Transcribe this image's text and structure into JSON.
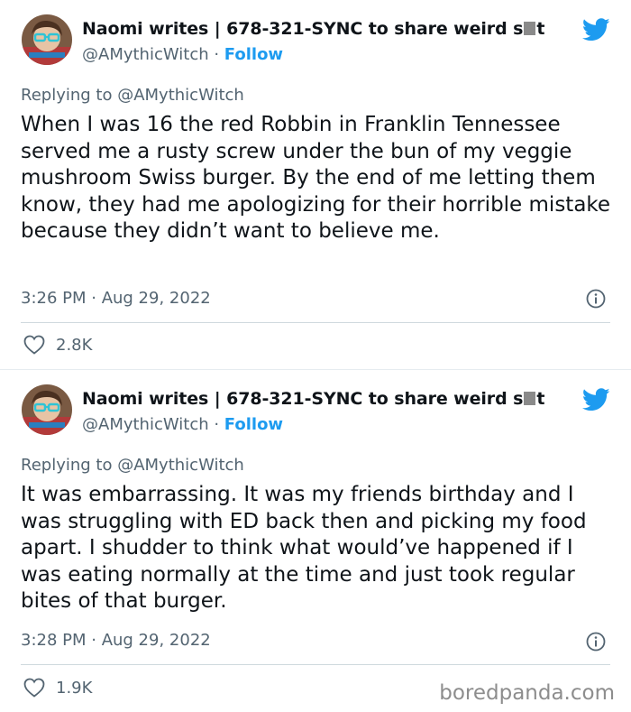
{
  "tweets": [
    {
      "name_before": "Naomi writes | 678-321-SYNC to share weird s",
      "name_after": "t",
      "handle": "@AMythicWitch",
      "separator": " · ",
      "follow_label": "Follow",
      "replying_prefix": "Replying to ",
      "replying_handle": "@AMythicWitch",
      "body": "When I was 16 the red Robbin in Franklin Tennessee served me a rusty screw under the bun of my veggie mushroom Swiss burger. By the end of me letting them know, they had me apologizing for their horrible mistake because they didn’t want to believe me.",
      "time": "3:26 PM · Aug 29, 2022",
      "likes": "2.8K"
    },
    {
      "name_before": "Naomi writes | 678-321-SYNC to share weird s",
      "name_after": "t",
      "handle": "@AMythicWitch",
      "separator": " · ",
      "follow_label": "Follow",
      "replying_prefix": "Replying to ",
      "replying_handle": "@AMythicWitch",
      "body": "It was embarrassing. It was my friends birthday and I was struggling with ED back then and picking my food apart. I shudder to think what would’ve happened if I was eating normally at the time and just took regular bites of that burger.",
      "time": "3:28 PM · Aug 29, 2022",
      "likes": "1.9K"
    }
  ],
  "watermark": "boredpanda.com",
  "icons": {
    "brand": "twitter-bird-icon",
    "info": "info-icon",
    "like": "heart-icon"
  },
  "colors": {
    "link": "#1d9bf0",
    "muted": "#536471",
    "text": "#0f1419"
  }
}
